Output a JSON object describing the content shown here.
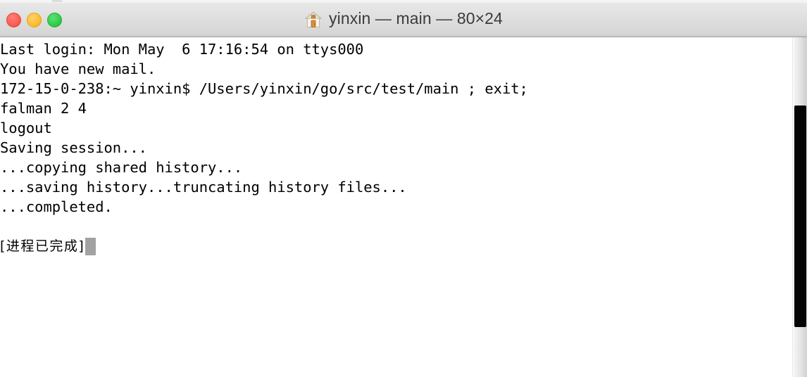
{
  "window": {
    "title_icon": "home-icon",
    "title": "yinxin — main — 80×24",
    "traffic_lights": {
      "close_label": "close",
      "minimize_label": "minimize",
      "maximize_label": "maximize",
      "close_color": "#fc5b52",
      "minimize_color": "#fdbc2c",
      "maximize_color": "#2ecc47"
    }
  },
  "terminal": {
    "background_color": "#ffffff",
    "text_color": "#000000",
    "cursor_color": "#a2a2a2",
    "columns": 80,
    "rows": 24,
    "lines": [
      "Last login: Mon May  6 17:16:54 on ttys000",
      "You have new mail.",
      "172-15-0-238:~ yinxin$ /Users/yinxin/go/src/test/main ; exit;",
      "falman 2 4",
      "logout",
      "Saving session...",
      "...copying shared history...",
      "...saving history...truncating history files...",
      "...completed.",
      ""
    ],
    "process_completed_text": "[进程已完成]"
  },
  "scrollbar": {
    "track_color": "#050505",
    "thumb_color": "#e2e2e2"
  }
}
